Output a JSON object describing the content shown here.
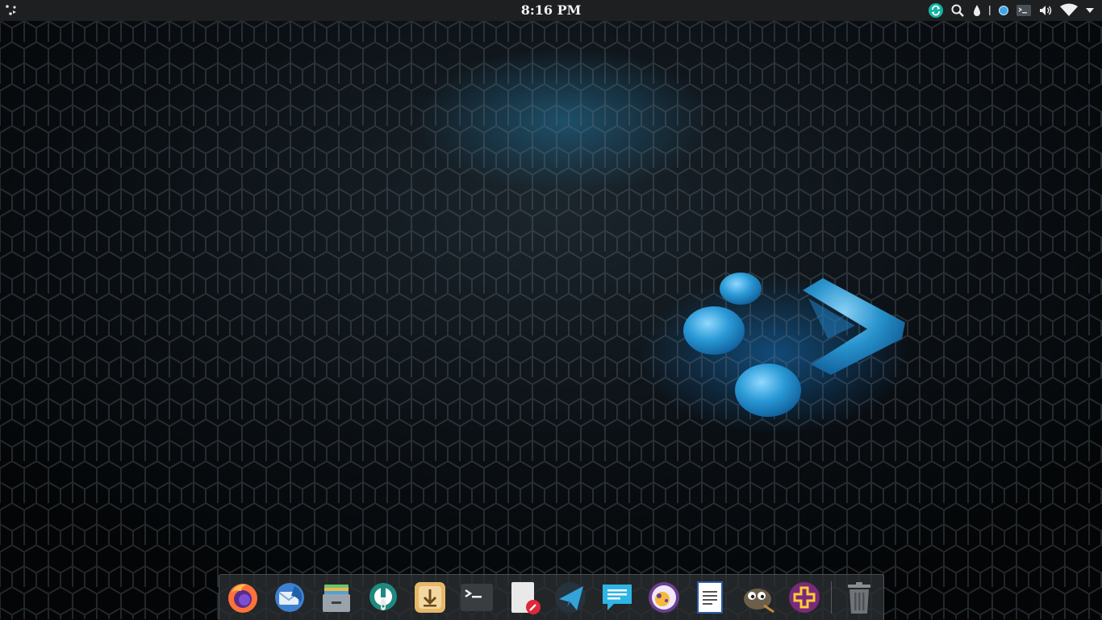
{
  "top_panel": {
    "clock": "8:16 PM",
    "tray_icons": [
      "app-menu-icon",
      "sync-icon",
      "search-icon",
      "droplet-icon",
      "night-light-icon",
      "terminal-indicator-icon",
      "volume-icon",
      "wifi-icon",
      "dropdown-arrow-icon"
    ]
  },
  "dock": {
    "apps": [
      {
        "name": "firefox-icon",
        "color": "#ff7139"
      },
      {
        "name": "thunderbird-mail-icon",
        "color": "#4a8fd8"
      },
      {
        "name": "file-manager-icon",
        "color": "#9aa3ab"
      },
      {
        "name": "settings-wrench-icon",
        "color": "#1e8a7f"
      },
      {
        "name": "download-manager-icon",
        "color": "#e7b86a"
      },
      {
        "name": "terminal-icon",
        "color": "#3a3d40"
      },
      {
        "name": "text-editor-icon",
        "color": "#e9e9e9"
      },
      {
        "name": "telegram-icon",
        "color": "#33a3d9"
      },
      {
        "name": "chat-messages-icon",
        "color": "#2fb4e6"
      },
      {
        "name": "cheese-camera-icon",
        "color": "#6a3f91"
      },
      {
        "name": "document-viewer-icon",
        "color": "#ffffff"
      },
      {
        "name": "gimp-icon",
        "color": "#6b5f4c"
      },
      {
        "name": "add-software-icon",
        "color": "#7a2a7a"
      },
      {
        "name": "trash-icon",
        "color": "#707478"
      }
    ]
  }
}
